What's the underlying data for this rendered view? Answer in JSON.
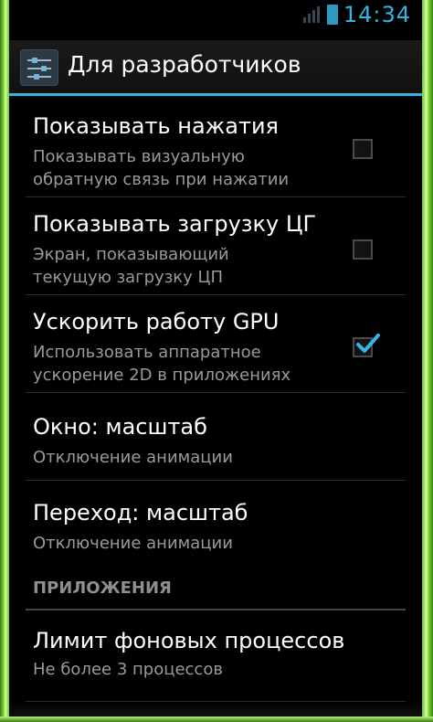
{
  "statusbar": {
    "time": "14:34"
  },
  "actionbar": {
    "title": "Для разработчиков"
  },
  "settings": [
    {
      "title": "Показывать нажатия",
      "summary_line1": "Показывать визуальную",
      "summary_line2": "обратную связь при нажатии",
      "checked": false
    },
    {
      "title": "Показывать загрузку ЦГ",
      "summary_line1": "Экран, показывающий",
      "summary_line2": "текущую загрузку ЦП",
      "checked": false
    },
    {
      "title": "Ускорить работу GPU",
      "summary_line1": "Использовать аппаратное",
      "summary_line2": "ускорение 2D в приложениях",
      "checked": true
    },
    {
      "title": "Окно: масштаб",
      "summary": "Отключение анимации"
    },
    {
      "title": "Переход: масштаб",
      "summary": "Отключение анимации"
    }
  ],
  "section_apps": {
    "label": "ПРИЛОЖЕНИЯ"
  },
  "bg_process": {
    "title": "Лимит фоновых процессов",
    "summary": "Не более 3 процессов"
  },
  "colors": {
    "accent": "#33b5e5",
    "frame_glow": "#7fd63a"
  }
}
